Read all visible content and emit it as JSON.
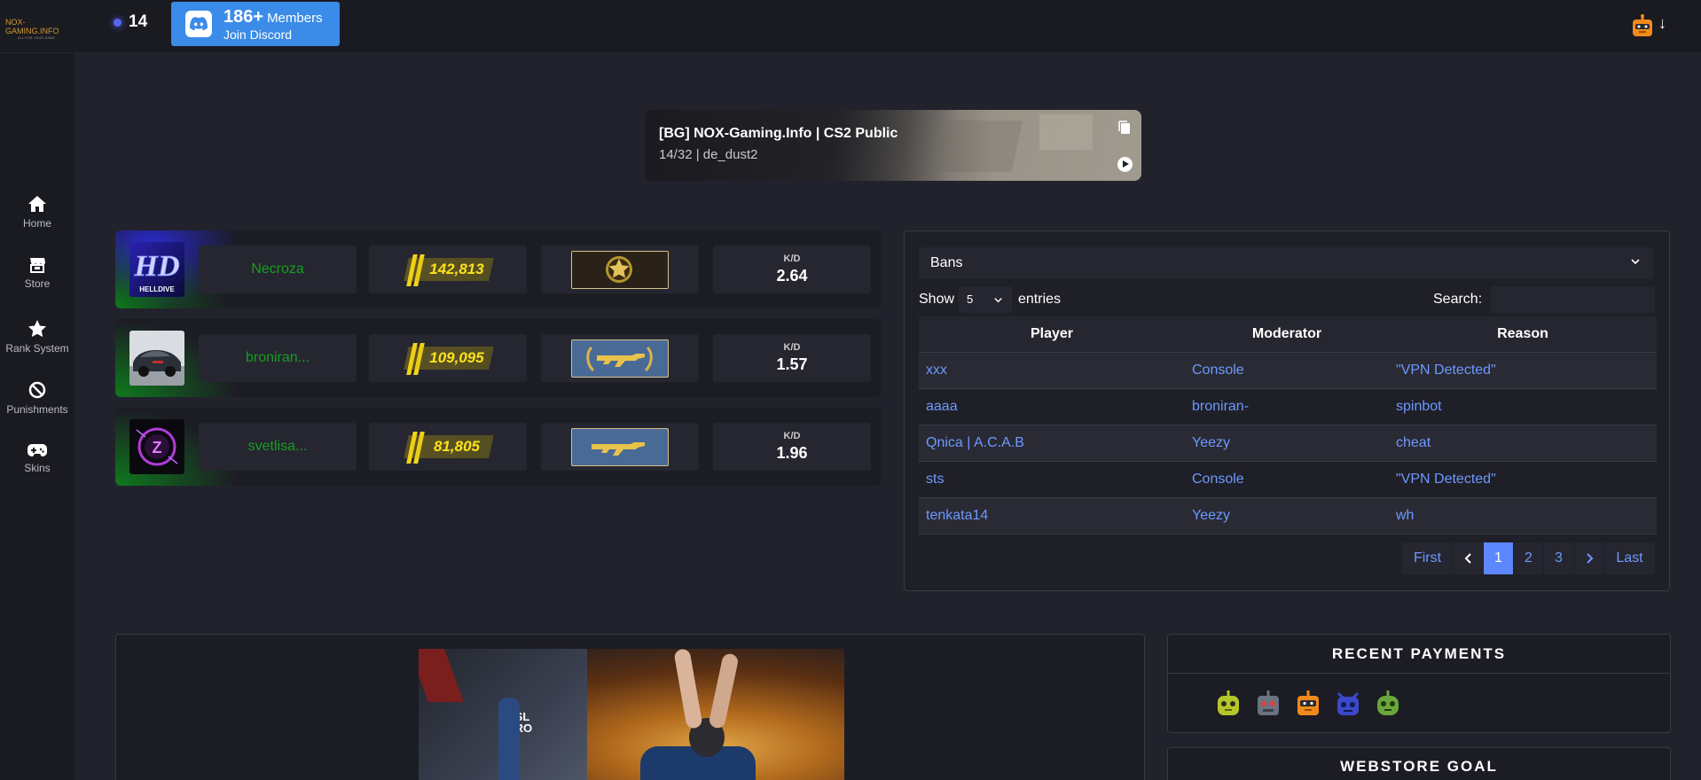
{
  "header": {
    "logo_text": "NOX-GAMING.INFO",
    "logo_sub": "ALL FOR YOUR GAME",
    "online_count": "14",
    "discord": {
      "members": "186+",
      "members_label": "Members",
      "join_label": "Join Discord"
    }
  },
  "sidebar": {
    "items": [
      {
        "label": "Home",
        "icon": "home-icon"
      },
      {
        "label": "Store",
        "icon": "store-icon"
      },
      {
        "label": "Rank System",
        "icon": "star-icon"
      },
      {
        "label": "Punishments",
        "icon": "ban-icon"
      },
      {
        "label": "Skins",
        "icon": "gamepad-icon"
      }
    ]
  },
  "server": {
    "name": "[BG] NOX-Gaming.Info | CS2 Public",
    "info": "14/32 | de_dust2"
  },
  "top_players": [
    {
      "name": "Necroza",
      "points": "142,813",
      "kd_label": "K/D",
      "kd": "2.64",
      "rank": "gold-star-rank"
    },
    {
      "name": "broniran...",
      "points": "109,095",
      "kd_label": "K/D",
      "kd": "1.57",
      "rank": "ak-wreath-rank"
    },
    {
      "name": "svetlisa...",
      "points": "81,805",
      "kd_label": "K/D",
      "kd": "1.96",
      "rank": "ak-rank"
    }
  ],
  "bans": {
    "select_label": "Bans",
    "show_label": "Show",
    "entries_value": "5",
    "entries_label": "entries",
    "search_label": "Search:",
    "columns": [
      "Player",
      "Moderator",
      "Reason"
    ],
    "rows": [
      {
        "player": "xxx",
        "moderator": "Console",
        "reason": "\"VPN Detected\""
      },
      {
        "player": "aaaa",
        "moderator": "broniran-",
        "reason": "spinbot"
      },
      {
        "player": "Qnica | A.C.A.B",
        "moderator": "Yeezy",
        "reason": "cheat"
      },
      {
        "player": "sts",
        "moderator": "Console",
        "reason": "\"VPN Detected\""
      },
      {
        "player": "tenkata14",
        "moderator": "Yeezy",
        "reason": "wh"
      }
    ],
    "pager": {
      "first": "First",
      "pages": [
        "1",
        "2",
        "3"
      ],
      "active": "1",
      "last": "Last"
    }
  },
  "payments": {
    "title": "RECENT PAYMENTS",
    "colors": [
      "#b5c62a",
      "#6b7380",
      "#f08a1a",
      "#3a49c8",
      "#6aa63a"
    ]
  },
  "goal": {
    "title": "WEBSTORE GOAL"
  },
  "colors": {
    "accent": "#5d87ff",
    "link": "#6d99ff",
    "discord": "#3b8be8",
    "name_green": "#14a01e",
    "points_yellow": "#ffe21a"
  }
}
